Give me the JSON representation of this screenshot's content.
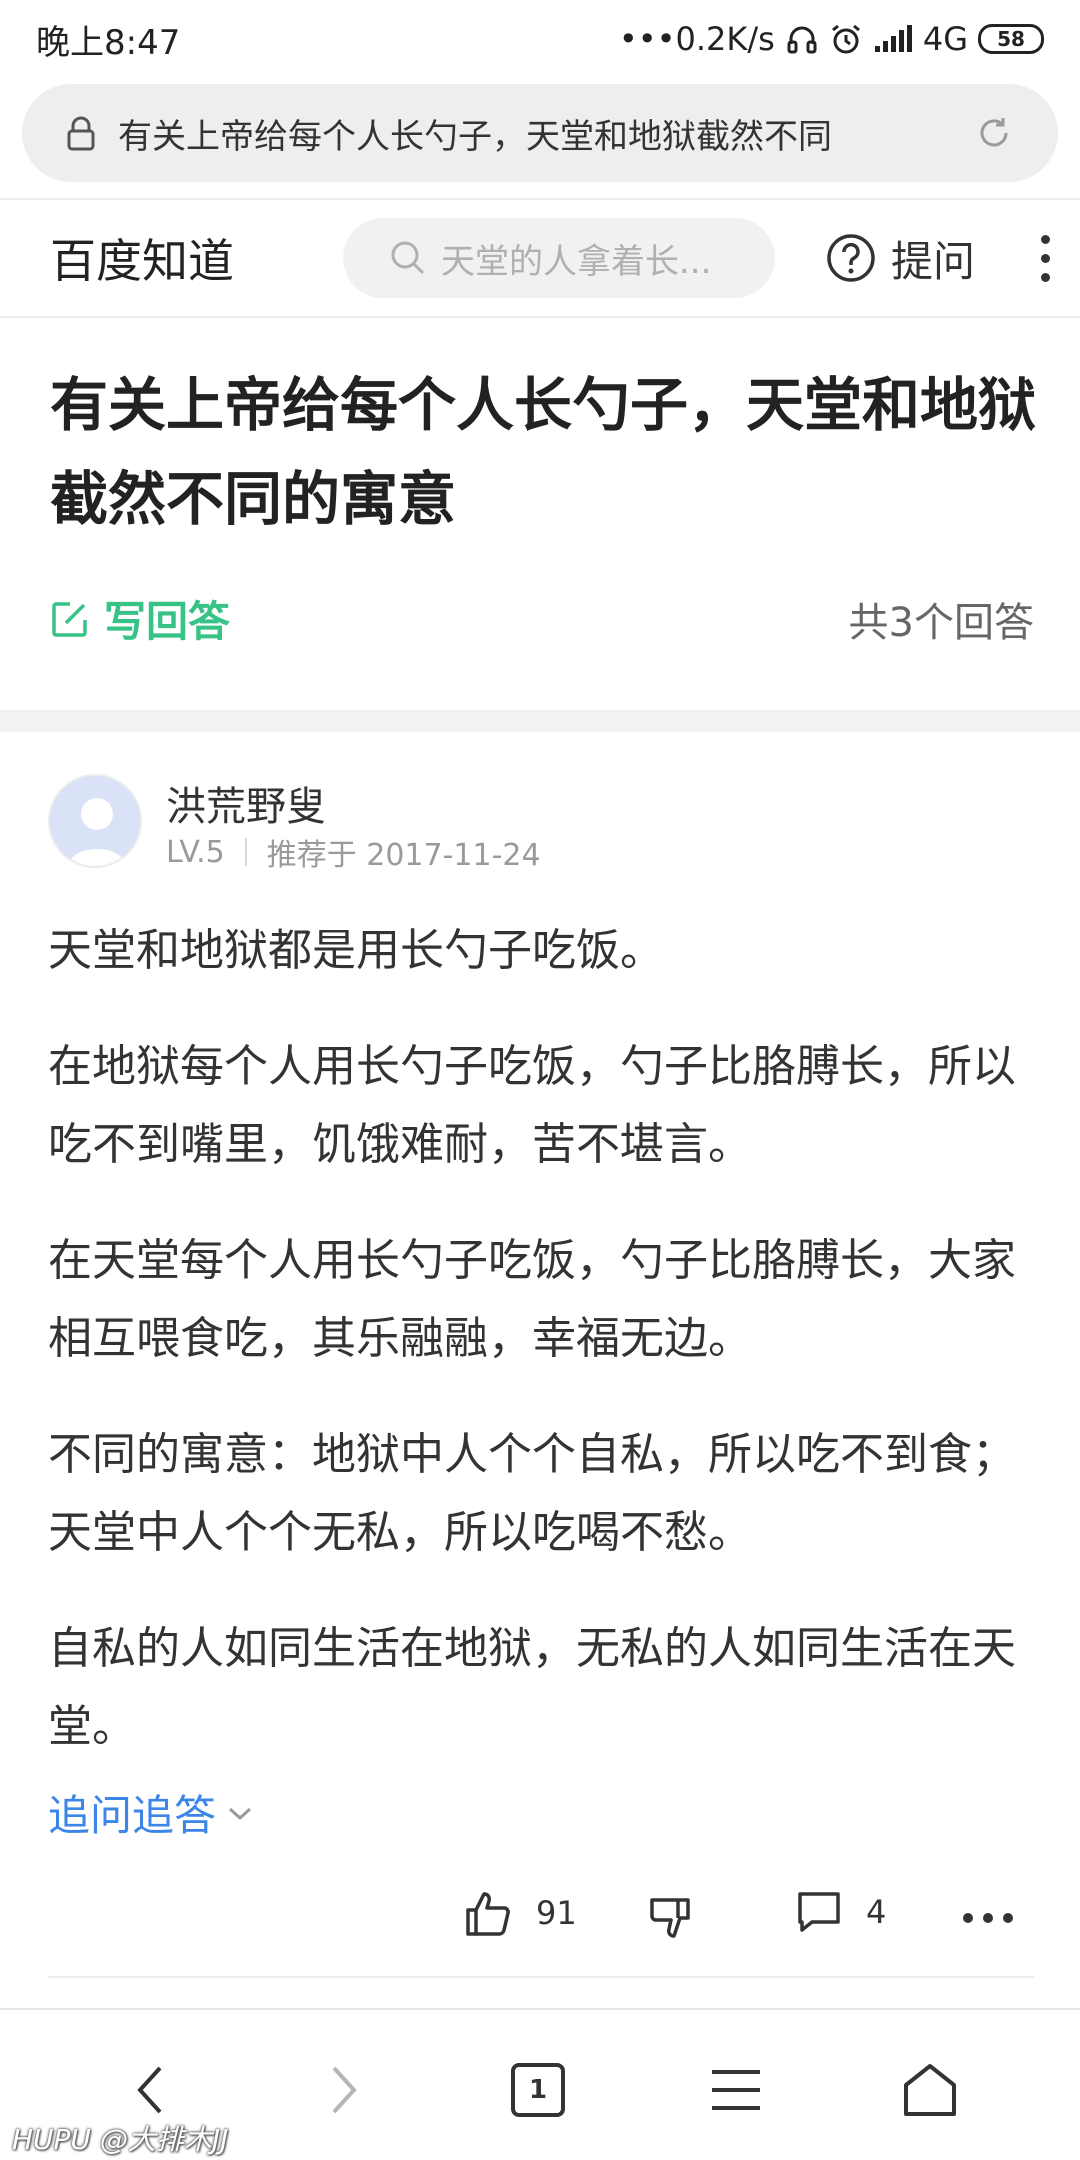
{
  "status_bar": {
    "time": "晚上8:47",
    "network_speed": "•••0.2K/s",
    "network_type": "4G",
    "battery": "58",
    "icons": [
      "headphones-icon",
      "alarm-icon",
      "signal-icon",
      "battery-icon"
    ]
  },
  "url_bar": {
    "url_text": "有关上帝给每个人长勺子，天堂和地狱截然不同",
    "icons": [
      "lock-icon",
      "refresh-icon"
    ]
  },
  "header": {
    "brand": "百度知道",
    "search_placeholder": "天堂的人拿着长...",
    "ask_label": "提问"
  },
  "question": {
    "title": "有关上帝给每个人长勺子，天堂和地狱截然不同的寓意",
    "write_answer_label": "写回答",
    "answer_count": "共3个回答"
  },
  "answer": {
    "author_name": "洪荒野叟",
    "author_level": "LV.5",
    "recommended": "推荐于 2017-11-24",
    "paragraphs": [
      "天堂和地狱都是用长勺子吃饭。",
      "在地狱每个人用长勺子吃饭，勺子比胳膊长，所以吃不到嘴里，饥饿难耐，苦不堪言。",
      "在天堂每个人用长勺子吃饭，勺子比胳膊长，大家相互喂食吃，其乐融融，幸福无边。",
      "不同的寓意：地狱中人个个自私，所以吃不到食；天堂中人个个无私，所以吃喝不愁。",
      "自私的人如同生活在地狱，无私的人如同生活在天堂。"
    ],
    "follow_up_label": "追问追答",
    "like_count": "91",
    "comment_count": "4"
  },
  "bottom_nav": {
    "tab_count": "1"
  },
  "watermark": "HUPU @大排木JJ",
  "colors": {
    "accent_green": "#37c385",
    "link_blue": "#3b86e8",
    "text_dark": "#222222"
  }
}
